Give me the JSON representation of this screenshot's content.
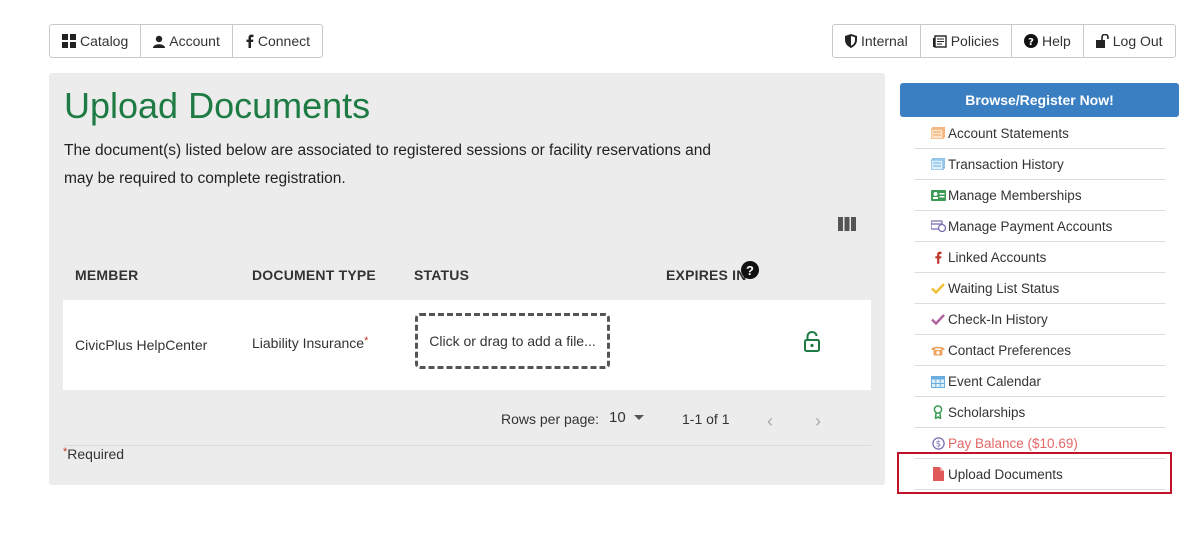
{
  "nav_left": {
    "catalog": {
      "label": "Catalog",
      "icon": "grid-icon"
    },
    "account": {
      "label": "Account",
      "icon": "user-icon"
    },
    "connect": {
      "label": "Connect",
      "icon": "facebook-icon"
    }
  },
  "nav_right": {
    "internal": {
      "label": "Internal",
      "icon": "shield-icon"
    },
    "policies": {
      "label": "Policies",
      "icon": "document-icon"
    },
    "help": {
      "label": "Help",
      "icon": "question-circle-icon"
    },
    "logout": {
      "label": "Log Out",
      "icon": "unlock-icon"
    }
  },
  "main": {
    "title": "Upload Documents",
    "intro": "The document(s) listed below are associated to registered sessions or facility reservations and may be required to complete registration.",
    "columns": [
      "MEMBER",
      "DOCUMENT TYPE",
      "STATUS",
      "EXPIRES IN"
    ],
    "rows": [
      {
        "member": "CivicPlus HelpCenter",
        "document_type": "Liability Insurance",
        "required_mark": "*",
        "status_placeholder": "Click or drag to add a file...",
        "expires_in": ""
      }
    ],
    "pagination": {
      "rows_per_page_label": "Rows per page:",
      "rows_per_page_value": "10",
      "range": "1-1 of 1",
      "prev": "‹",
      "next": "›"
    },
    "required_note": {
      "mark": "*",
      "text": "Required"
    }
  },
  "sidebar": {
    "browse_button": "Browse/Register Now!",
    "items": [
      {
        "label": "Account Statements",
        "icon": "statement-icon",
        "color": "#f0a35e"
      },
      {
        "label": "Transaction History",
        "icon": "history-icon",
        "color": "#6aaee0"
      },
      {
        "label": "Manage Memberships",
        "icon": "membership-card-icon",
        "color": "#3c9a55"
      },
      {
        "label": "Manage Payment Accounts",
        "icon": "payment-icon",
        "color": "#7b6fb0"
      },
      {
        "label": "Linked Accounts",
        "icon": "facebook-icon",
        "color": "#c0392b"
      },
      {
        "label": "Waiting List Status",
        "icon": "check-icon",
        "color": "#f2c037"
      },
      {
        "label": "Check-In History",
        "icon": "check-icon",
        "color": "#b25fa3"
      },
      {
        "label": "Contact Preferences",
        "icon": "phone-icon",
        "color": "#f0a35e"
      },
      {
        "label": "Event Calendar",
        "icon": "calendar-icon",
        "color": "#6aaee0"
      },
      {
        "label": "Scholarships",
        "icon": "award-icon",
        "color": "#3c9a55"
      },
      {
        "label": "Pay Balance ($10.69)",
        "icon": "dollar-circle-icon",
        "color": "#7b6fb0"
      },
      {
        "label": "Upload Documents",
        "icon": "file-icon",
        "color": "#e05a5a"
      }
    ]
  },
  "colors": {
    "title_green": "#1e7b43",
    "browse_blue": "#3a7fc1",
    "highlight_red": "#c1122c",
    "pay_balance_red": "#e36767"
  }
}
